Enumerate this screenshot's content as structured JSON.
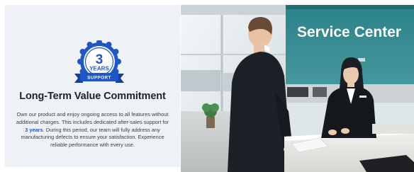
{
  "badge": {
    "number": "3",
    "years": "YEARS",
    "ribbon": "SUPPORT",
    "color": "#1f57c8"
  },
  "headline": "Long-Term Value Commitment",
  "description": {
    "part1": "Own our product and enjoy ongoing access to all features without additional charges. This includes dedicated after-sales support for ",
    "highlight": "3 years",
    "part2": ". During this period, our team will fully address any manufacturing defects to ensure your satisfaction. Experience reliable performance with every use."
  },
  "photo": {
    "wall_sign": "Service Center",
    "accent_color": "#2f7f85"
  }
}
